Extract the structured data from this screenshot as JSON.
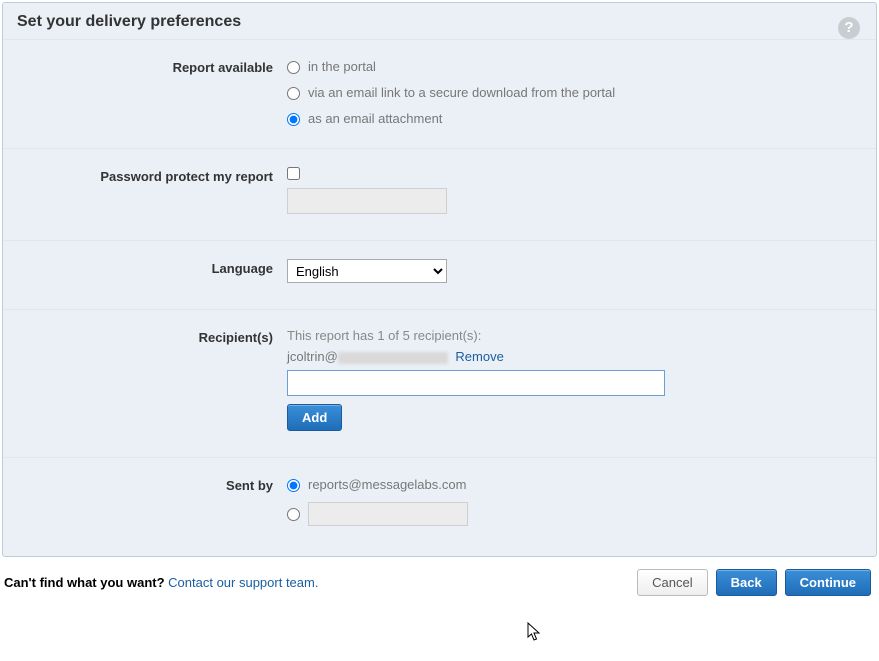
{
  "panel": {
    "title": "Set your delivery preferences",
    "helpTooltip": "?"
  },
  "reportAvailable": {
    "label": "Report available",
    "options": {
      "portal": "in the portal",
      "emailLink": "via an email link to a secure download from the portal",
      "attachment": "as an email attachment"
    },
    "selected": "attachment"
  },
  "passwordProtect": {
    "label": "Password protect my report",
    "checked": false,
    "value": ""
  },
  "language": {
    "label": "Language",
    "selected": "English",
    "options": [
      "English"
    ]
  },
  "recipients": {
    "label": "Recipient(s)",
    "info": "This report has 1 of 5 recipient(s):",
    "list": [
      {
        "emailVisiblePart": "jcoltrin@",
        "removeLabel": "Remove"
      }
    ],
    "inputValue": "",
    "addLabel": "Add"
  },
  "sentBy": {
    "label": "Sent by",
    "defaultEmail": "reports@messagelabs.com",
    "selected": "default",
    "customValue": ""
  },
  "footer": {
    "promptBold": "Can't find what you want?",
    "linkText": "Contact our support team.",
    "cancel": "Cancel",
    "back": "Back",
    "continue": "Continue"
  }
}
